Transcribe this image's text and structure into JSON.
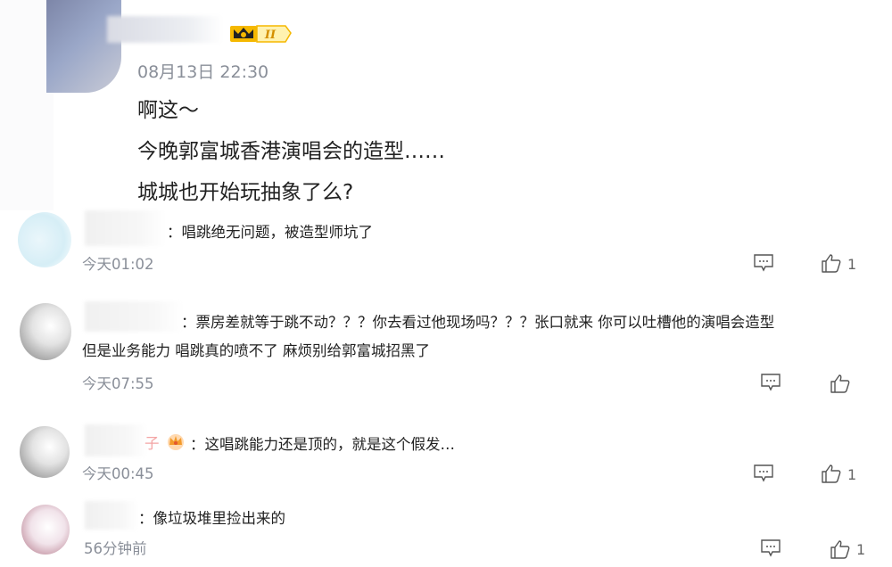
{
  "post": {
    "time": "08月13日 22:30",
    "lines": [
      "啊这～",
      "今晚郭富城香港演唱会的造型……",
      "城城也开始玩抽象了么?"
    ],
    "badge_level": "II"
  },
  "replies": [
    {
      "text": "：唱跳绝无问题，被造型师坑了",
      "time": "今天01:02",
      "likes": "1"
    },
    {
      "text_line1": "：票房差就等于跳不动？？？你去看过他现场吗？？？张口就来 你可以吐槽他的演唱会造型",
      "text_line2": "但是业务能力 唱跳真的喷不了 麻烦别给郭富城招黑了",
      "time": "今天07:55",
      "likes": ""
    },
    {
      "name_tail": "子",
      "text": "：这唱跳能力还是顶的，就是这个假发…",
      "time": "今天00:45",
      "likes": "1"
    },
    {
      "text": "：像垃圾堆里捡出来的",
      "time": "56分钟前",
      "likes": "1"
    }
  ],
  "icons": {
    "comment": "comment-icon",
    "like": "thumbs-up-icon",
    "badge": "crown-badge-icon"
  },
  "colors": {
    "text": "#222222",
    "meta": "#8a8f99",
    "badge": "#f5b800"
  }
}
